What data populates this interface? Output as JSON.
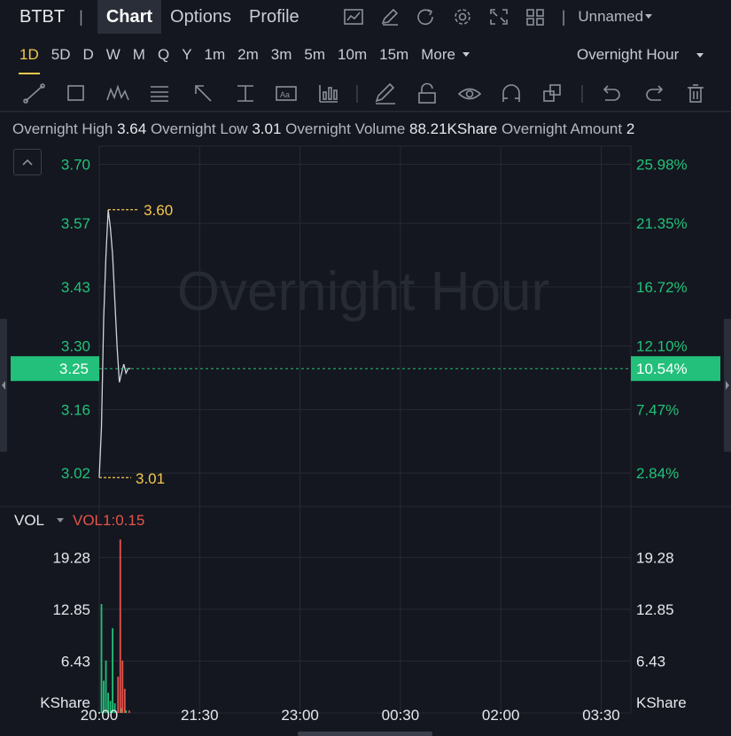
{
  "header": {
    "ticker": "BTBT",
    "tabs": [
      "Chart",
      "Options",
      "Profile"
    ],
    "active_tab": "Chart",
    "layout_name": "Unnamed",
    "tool_icons": [
      "chart-icon",
      "edit-icon",
      "refresh-icon",
      "settings-icon",
      "fullscreen-icon",
      "grid-layout-icon"
    ]
  },
  "periods": {
    "items": [
      "1D",
      "5D",
      "D",
      "W",
      "M",
      "Q",
      "Y",
      "1m",
      "2m",
      "3m",
      "5m",
      "10m",
      "15m",
      "More"
    ],
    "active": "1D",
    "session": "Overnight Hour"
  },
  "draw_tools": [
    "line-tool-icon",
    "rectangle-tool-icon",
    "pattern-tool-icon",
    "fibonacci-tool-icon",
    "arrow-tool-icon",
    "measure-tool-icon",
    "text-tool-icon",
    "indicator-tool-icon",
    "pen-tool-icon",
    "lock-icon",
    "eye-icon",
    "magnet-icon",
    "layers-icon",
    "undo-icon",
    "redo-icon",
    "trash-icon"
  ],
  "stats": {
    "high_label": "Overnight High",
    "high_value": "3.64",
    "low_label": "Overnight Low",
    "low_value": "3.01",
    "volume_label": "Overnight Volume",
    "volume_value": "88.21KShare",
    "amount_label": "Overnight Amount",
    "amount_value": "2"
  },
  "watermark": "Overnight Hour",
  "price_axis": {
    "left_ticks": [
      "3.70",
      "3.57",
      "3.43",
      "3.30",
      "3.16",
      "3.02"
    ],
    "right_ticks": [
      "25.98%",
      "21.35%",
      "16.72%",
      "12.10%",
      "7.47%",
      "2.84%"
    ],
    "current_price": "3.25",
    "current_pct": "10.54%",
    "max_marker": "3.60",
    "min_marker": "3.01"
  },
  "volume_panel": {
    "label": "VOL",
    "indicator": "VOL1:0.15",
    "ticks": [
      "19.28",
      "12.85",
      "6.43"
    ],
    "unit": "KShare"
  },
  "time_axis": [
    "20:00",
    "21:30",
    "23:00",
    "00:30",
    "02:00",
    "03:30"
  ],
  "colors": {
    "up": "#22c07a",
    "down": "#e5534b",
    "marker": "#f5c84c",
    "price_line": "#d0d3da",
    "background": "#14171f"
  },
  "chart_data": {
    "type": "line",
    "price_series": {
      "x": [
        "20:00",
        "20:02",
        "20:04",
        "20:06",
        "20:08",
        "20:10",
        "20:12",
        "20:14",
        "20:16",
        "20:18",
        "20:20",
        "20:22",
        "20:24",
        "20:26",
        "20:28"
      ],
      "y": [
        3.01,
        3.12,
        3.36,
        3.5,
        3.6,
        3.56,
        3.5,
        3.4,
        3.3,
        3.22,
        3.24,
        3.26,
        3.24,
        3.25,
        3.25
      ]
    },
    "volume_series": {
      "x": [
        "20:00",
        "20:02",
        "20:04",
        "20:06",
        "20:08",
        "20:10",
        "20:12",
        "20:14",
        "20:16",
        "20:18",
        "20:20",
        "20:22",
        "20:24",
        "20:26"
      ],
      "up": [
        0,
        13.5,
        4.0,
        6.5,
        2.5,
        1.5,
        10.5,
        1.2,
        0,
        0,
        0.6,
        0,
        0.3,
        0
      ],
      "down": [
        0,
        0,
        0,
        0,
        0,
        0,
        0,
        0,
        4.5,
        21.5,
        6.5,
        3.0,
        0,
        0.3
      ]
    },
    "ylim": [
      2.95,
      3.74
    ],
    "volume_ylim": [
      0,
      22.5
    ]
  }
}
